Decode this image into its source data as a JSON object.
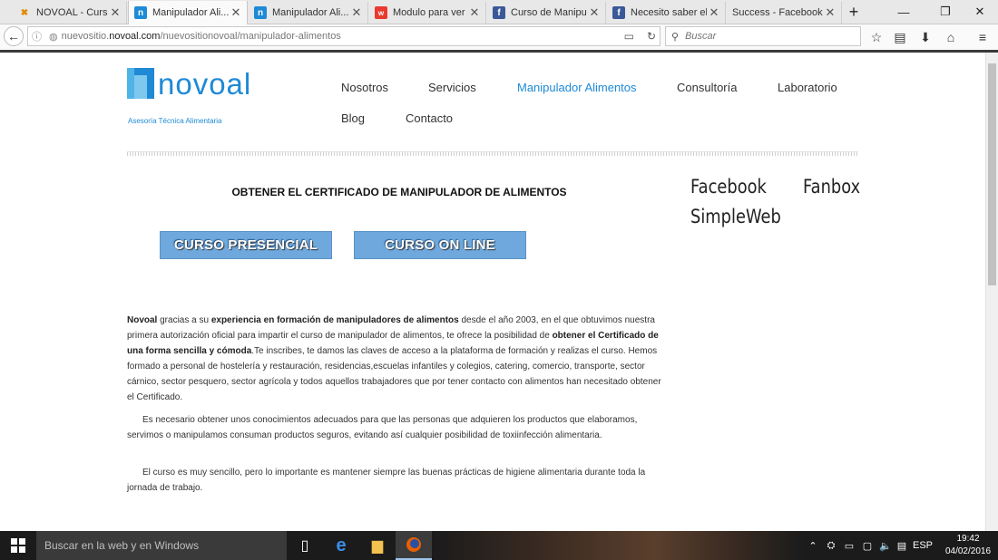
{
  "browser": {
    "tabs": [
      {
        "title": "NOVOAL - Curso...",
        "favicon": "x-icon",
        "active": false
      },
      {
        "title": "Manipulador Ali...",
        "favicon": "n-icon",
        "active": true
      },
      {
        "title": "Manipulador Ali...",
        "favicon": "n-icon",
        "active": false
      },
      {
        "title": "Modulo para ver ...",
        "favicon": "w-icon",
        "active": false
      },
      {
        "title": "Curso de Manipu...",
        "favicon": "facebook-icon",
        "active": false
      },
      {
        "title": "Necesito saber el...",
        "favicon": "facebook-icon",
        "active": false
      },
      {
        "title": "Success - Facebook l...",
        "favicon": "none",
        "active": false
      }
    ],
    "new_tab_label": "+",
    "url_prefix": "nuevositio.",
    "url_domain": "novoal.com",
    "url_path": "/nuevositionovoal/manipulador-alimentos",
    "search_placeholder": "Buscar"
  },
  "site": {
    "logo_text": "novoal",
    "logo_tagline": "Asesoría Técnica Alimentaria",
    "nav": [
      {
        "label": "Nosotros",
        "active": false
      },
      {
        "label": "Servicios",
        "active": false
      },
      {
        "label": "Manipulador Alimentos",
        "active": true
      },
      {
        "label": "Consultoría",
        "active": false
      },
      {
        "label": "Laboratorio",
        "active": false
      },
      {
        "label": "Blog",
        "active": false
      },
      {
        "label": "Contacto",
        "active": false
      }
    ],
    "accent_color": "#1e8ad6"
  },
  "main": {
    "title": "OBTENER EL CERTIFICADO DE MANIPULADOR DE ALIMENTOS",
    "buttons": {
      "presencial": "CURSO PRESENCIAL",
      "online": "CURSO ON LINE"
    },
    "para1": {
      "s1": "Novoal",
      "s2": " gracias a su ",
      "s3": "experiencia en formación de manipuladores de alimentos",
      "s4": " desde el año 2003, en el que obtuvimos nuestra primera autorización oficial para impartir el curso de manipulador de alimentos, te ofrece la posibilidad de ",
      "s5": "obtener el Certificado de una forma sencilla y cómoda",
      "s6": ".Te inscribes, te damos las claves de acceso a la plataforma de formación y realizas el curso. Hemos formado a personal de hostelería y restauración, residencias,escuelas infantiles y colegios, catering, comercio, transporte, sector cárnico, sector pesquero, sector agrícola y todos aquellos trabajadores que por tener contacto con alimentos han necesitado obtener el Certificado."
    },
    "para2": "Es necesario obtener unos conocimientos adecuados para que las personas que adquieren los productos que elaboramos, servimos o manipulamos consuman productos seguros, evitando así cualquier posibilidad de toxiinfección alimentaria.",
    "para3": "El curso es muy sencillo, pero lo importante es mantener siempre las buenas prácticas de higiene alimentaria durante toda la jornada de trabajo."
  },
  "sidebar": {
    "facebook": "Facebook",
    "fanbox": "Fanbox",
    "simpleweb": "SimpleWeb"
  },
  "taskbar": {
    "search_placeholder": "Buscar en la web y en Windows",
    "language": "ESP",
    "time": "19:42",
    "date": "04/02/2016"
  }
}
